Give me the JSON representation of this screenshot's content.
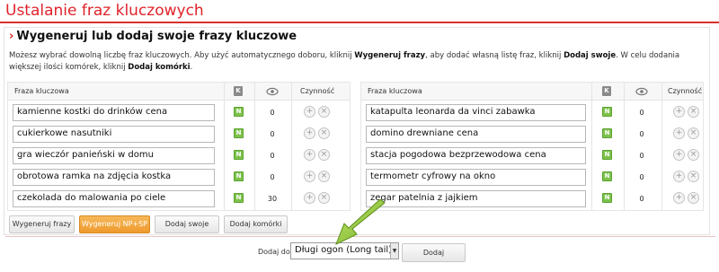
{
  "page": {
    "title": "Ustalanie fraz kluczowych"
  },
  "section": {
    "chevron": "›",
    "title": "Wygeneruj lub dodaj swoje frazy kluczowe",
    "desc_part1": "Możesz wybrać dowolną liczbę fraz kluczowych. Aby użyć automatycznego doboru, kliknij ",
    "desc_bold1": "Wygeneruj frazy",
    "desc_part2": ", aby dodać własną listę fraz, kliknij ",
    "desc_bold2": "Dodaj swoje",
    "desc_part3": ". W celu dodania większej ilości komórek, kliknij ",
    "desc_bold3": "Dodaj komórki",
    "desc_part4": "."
  },
  "table": {
    "col_phrase": "Fraza kluczowa",
    "col_k": "K",
    "col_actions": "Czynność",
    "badge": "N",
    "plus": "+",
    "minus": "×",
    "left_rows": [
      {
        "phrase": "kamienne kostki do drinków cena",
        "count": "0"
      },
      {
        "phrase": "cukierkowe nasutniki",
        "count": "0"
      },
      {
        "phrase": "gra wieczór panieński w domu",
        "count": "0"
      },
      {
        "phrase": "obrotowa ramka na zdjęcia kostka",
        "count": "0"
      },
      {
        "phrase": "czekolada do malowania po ciele",
        "count": "30"
      }
    ],
    "right_rows": [
      {
        "phrase": "katapulta leonarda da vinci zabawka",
        "count": "0"
      },
      {
        "phrase": "domino drewniane cena",
        "count": "0"
      },
      {
        "phrase": "stacja pogodowa bezprzewodowa cena",
        "count": "0"
      },
      {
        "phrase": "termometr cyfrowy na okno",
        "count": "0"
      },
      {
        "phrase": "zegar patelnia z jajkiem",
        "count": "0"
      }
    ]
  },
  "buttons": {
    "generate": "Wygeneruj frazy",
    "generate_np": "Wygeneruj NP+SP",
    "add_own": "Dodaj swoje",
    "add_cells": "Dodaj komórki"
  },
  "footer": {
    "add_to_label": "Dodaj do",
    "select_value": "Długi ogon (Long tail)",
    "add_button": "Dodaj"
  },
  "colors": {
    "accent": "#e1232b",
    "orange_button": "#ee9a2c",
    "badge_green": "#7cc24b",
    "arrow_green": "#8fc23a"
  }
}
